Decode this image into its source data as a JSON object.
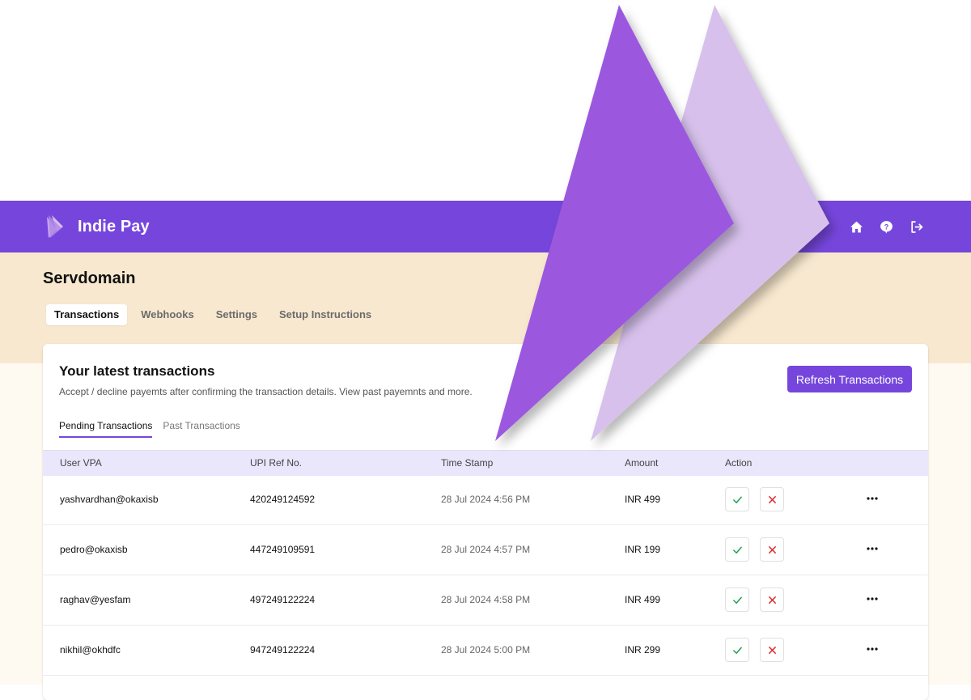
{
  "app": {
    "name": "Indie Pay"
  },
  "nav_icons": [
    {
      "name": "home-icon"
    },
    {
      "name": "help-icon"
    },
    {
      "name": "logout-icon"
    }
  ],
  "project": {
    "title": "Servdomain"
  },
  "tabs": [
    {
      "label": "Transactions",
      "active": true
    },
    {
      "label": "Webhooks",
      "active": false
    },
    {
      "label": "Settings",
      "active": false
    },
    {
      "label": "Setup Instructions",
      "active": false
    }
  ],
  "card": {
    "title": "Your latest transactions",
    "subtitle": "Accept / decline payemts after confirming the transaction details. View past payemnts and more.",
    "refresh_label": "Refresh Transactions"
  },
  "subtabs": [
    {
      "label": "Pending Transactions",
      "active": true
    },
    {
      "label": "Past Transactions",
      "active": false
    }
  ],
  "table": {
    "headers": {
      "vpa": "User VPA",
      "ref": "UPI Ref No.",
      "time": "Time Stamp",
      "amount": "Amount",
      "action": "Action"
    },
    "rows": [
      {
        "vpa": "yashvardhan@okaxisb",
        "ref": "420249124592",
        "time": "28 Jul 2024 4:56 PM",
        "amount": "INR 499"
      },
      {
        "vpa": "pedro@okaxisb",
        "ref": "447249109591",
        "time": "28 Jul 2024 4:57 PM",
        "amount": "INR 199"
      },
      {
        "vpa": "raghav@yesfam",
        "ref": "497249122224",
        "time": "28 Jul 2024 4:58 PM",
        "amount": "INR 499"
      },
      {
        "vpa": "nikhil@okhdfc",
        "ref": "947249122224",
        "time": "28 Jul 2024 5:00 PM",
        "amount": "INR 299"
      }
    ]
  },
  "colors": {
    "brand": "#7646dc",
    "header_band": "#f8e8cf",
    "table_header": "#eae6fb",
    "accept": "#22a04a",
    "decline": "#dc2626",
    "logo_dark": "#9b59df",
    "logo_light": "#d7c1ec"
  }
}
